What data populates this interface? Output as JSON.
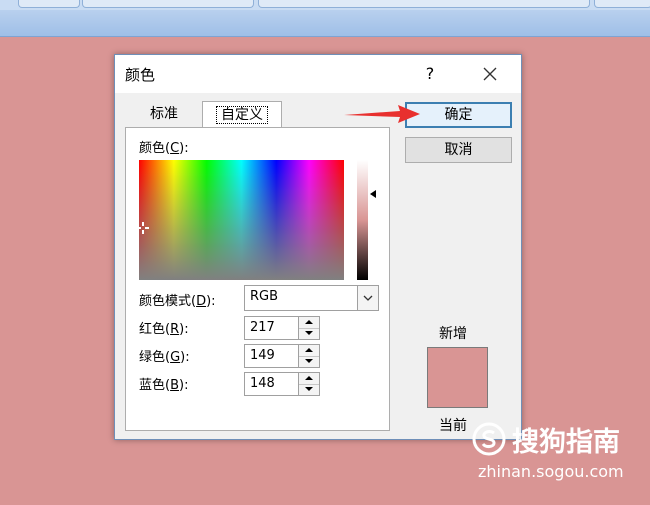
{
  "dialog": {
    "title": "颜色",
    "help": "?"
  },
  "tabs": {
    "standard": "标准",
    "custom": "自定义"
  },
  "custom_panel": {
    "colors_label": "颜色(",
    "colors_key": "C",
    "colors_suffix": "):",
    "mode_label": "颜色模式(",
    "mode_key": "D",
    "mode_suffix": "):",
    "mode_value": "RGB",
    "red_label": "红色(",
    "red_key": "R",
    "red_suffix": "):",
    "red_value": "217",
    "green_label": "绿色(",
    "green_key": "G",
    "green_suffix": "):",
    "green_value": "149",
    "blue_label": "蓝色(",
    "blue_key": "B",
    "blue_suffix": "):",
    "blue_value": "148"
  },
  "buttons": {
    "ok": "确定",
    "cancel": "取消"
  },
  "preview": {
    "new_label": "新增",
    "current_label": "当前",
    "color": "#d99594"
  },
  "watermark": {
    "name": "搜狗指南",
    "url": "zhinan.sogou.com"
  },
  "colors": {
    "background": "#d99594",
    "accent": "#3c7fb1",
    "annotation_arrow": "#e8302e"
  }
}
